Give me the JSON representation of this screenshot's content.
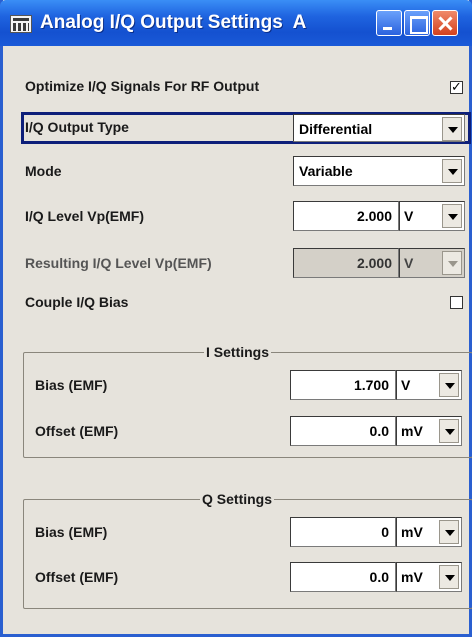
{
  "window": {
    "title": "Analog I/Q Output Settings  A"
  },
  "rows": {
    "optimize": {
      "label": "Optimize I/Q Signals For RF Output",
      "checked": true
    },
    "output_type": {
      "label": "I/Q Output Type",
      "value": "Differential"
    },
    "mode": {
      "label": "Mode",
      "value": "Variable"
    },
    "level": {
      "label": "I/Q Level Vp(EMF)",
      "value": "2.000",
      "unit": "V"
    },
    "resulting_level": {
      "label": "Resulting I/Q Level Vp(EMF)",
      "value": "2.000",
      "unit": "V",
      "disabled": true
    },
    "couple_bias": {
      "label": "Couple I/Q Bias",
      "checked": false
    }
  },
  "i_settings": {
    "title": "I Settings",
    "bias": {
      "label": "Bias (EMF)",
      "value": "1.700",
      "unit": "V"
    },
    "offset": {
      "label": "Offset (EMF)",
      "value": "0.0",
      "unit": "mV"
    }
  },
  "q_settings": {
    "title": "Q Settings",
    "bias": {
      "label": "Bias (EMF)",
      "value": "0",
      "unit": "mV"
    },
    "offset": {
      "label": "Offset (EMF)",
      "value": "0.0",
      "unit": "mV"
    }
  },
  "icons": {
    "app": "instrument-icon",
    "minimize": "minimize-icon",
    "maximize": "maximize-icon",
    "close": "close-icon",
    "dropdown": "chevron-down-icon"
  },
  "colors": {
    "titlebar": "#1f64e0",
    "body": "#e6e3dc",
    "focus_frame": "#0d1f7a",
    "close_button": "#d3411e"
  }
}
